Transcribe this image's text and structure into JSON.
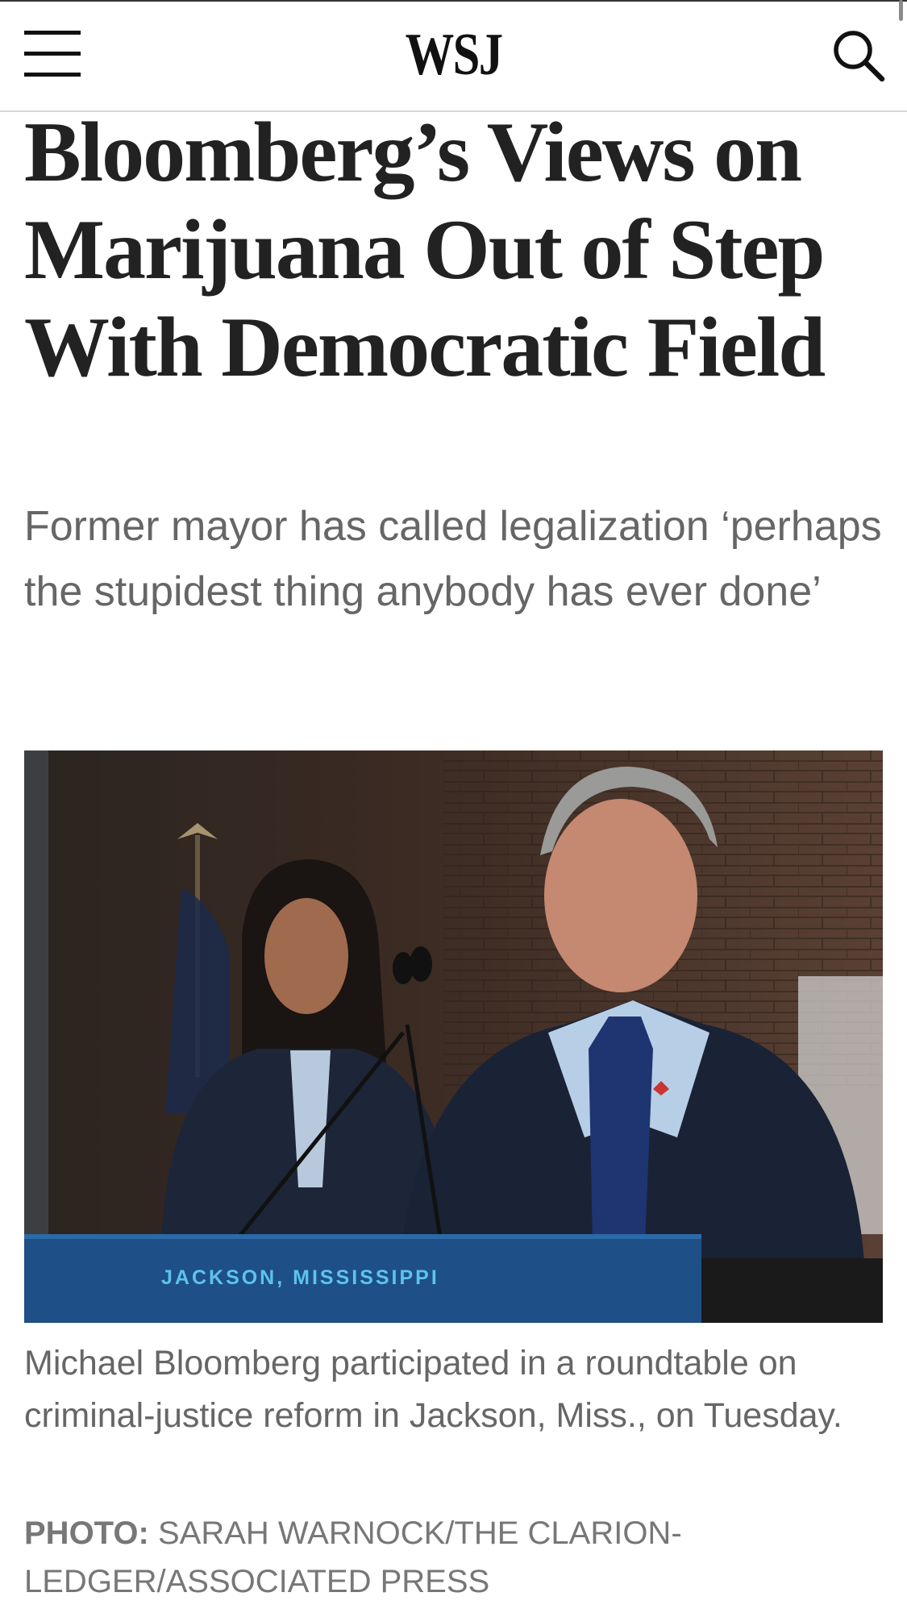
{
  "header": {
    "logo": "WSJ",
    "menu_icon": "hamburger-menu-icon",
    "search_icon": "search-icon"
  },
  "article": {
    "headline": "Bloomberg’s Views on Marijuana Out of Step With Democratic Field",
    "dek": "Former mayor has called legalization ‘perhaps the stupidest thing anybody has ever done’",
    "photo": {
      "podium_text": "JACKSON, MISSISSIPPI",
      "caption": "Michael Bloomberg participated in a roundtable on criminal-justice reform in Jackson, Miss., on Tuesday.",
      "credit_label": "PHOTO:",
      "credit": "SARAH WARNOCK/THE CLARION-LEDGER/ASSOCIATED PRESS"
    }
  },
  "colors": {
    "podium": "#1e4f86",
    "podium_text": "#5cc3ee"
  }
}
